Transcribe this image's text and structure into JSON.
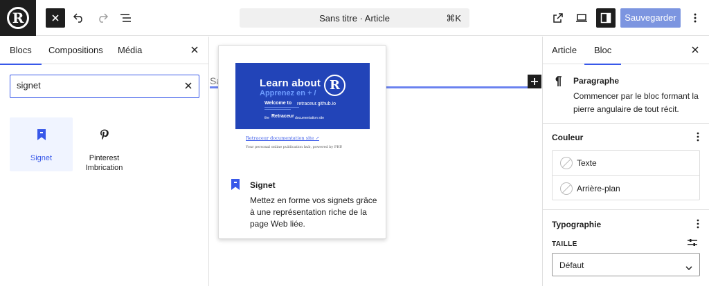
{
  "topbar": {
    "logo_letter": "R",
    "document_title": "Sans titre · Article",
    "shortcut": "⌘K",
    "save_label": "Sauvegarder",
    "icons": [
      "close-icon",
      "undo-icon",
      "redo-icon",
      "list-view-icon",
      "external-link-icon",
      "desktop-view-icon",
      "settings-panel-icon",
      "more-vertical-icon"
    ]
  },
  "inserter": {
    "tabs": [
      "Blocs",
      "Compositions",
      "Média"
    ],
    "active_tab": "Blocs",
    "search_value": "signet",
    "results": [
      {
        "label": "Signet",
        "icon": "bookmark-icon",
        "selected": true
      },
      {
        "label": "Pinterest Imbrication",
        "icon": "pinterest-icon",
        "selected": false
      }
    ]
  },
  "canvas": {
    "paragraph_placeholder": "Sa"
  },
  "preview": {
    "image_title": "Learn about",
    "image_subtitle": "Apprenez en + /",
    "image_welcome": "Welcome to",
    "image_site": "retraceur.github.io",
    "image_retraceur": "Retraceur",
    "image_the": "the",
    "image_documentation": "documentation site",
    "link_text": "Retraceur documentation site ↗",
    "description_small": "Your personal online publication hub, powered by PHP.",
    "block_name": "Signet",
    "block_description": "Mettez en forme vos signets grâce à une représentation riche de la page Web liée."
  },
  "sidebar": {
    "tabs": [
      "Article",
      "Bloc"
    ],
    "active_tab": "Bloc",
    "block_name": "Paragraphe",
    "block_description": "Commencer par le bloc formant la pierre angulaire de tout récit.",
    "color_title": "Couleur",
    "color_items": [
      "Texte",
      "Arrière-plan"
    ],
    "typography_title": "Typographie",
    "size_label": "TAILLE",
    "size_value": "Défaut"
  },
  "colors": {
    "accent": "#3858e9",
    "save_button": "#7c95e0",
    "dark": "#1e1e1e",
    "preview_bg": "#2244b8"
  }
}
